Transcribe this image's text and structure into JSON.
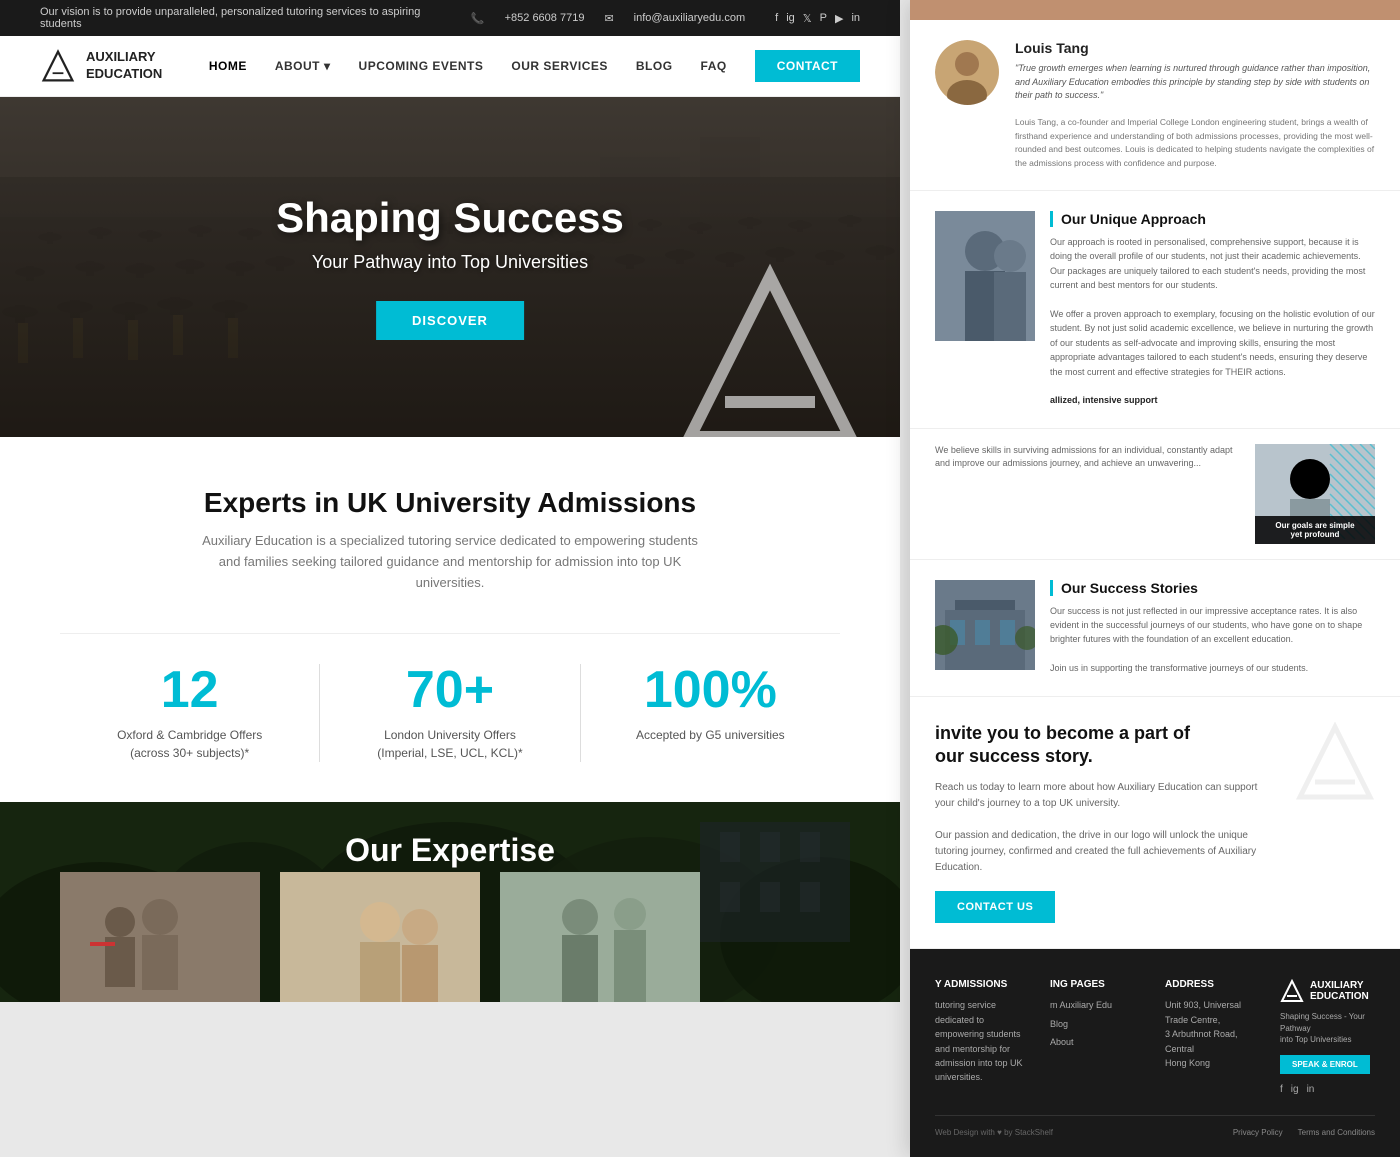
{
  "topbar": {
    "vision_text": "Our vision is to provide unparalleled, personalized tutoring services to aspiring students",
    "phone": "+852 6608 7719",
    "email": "info@auxiliaryedu.com",
    "social_icons": [
      "f",
      "ig",
      "tw",
      "pin",
      "yt",
      "in"
    ]
  },
  "navbar": {
    "logo_name": "AUXILIARY\nEDUCATION",
    "links": [
      {
        "label": "HOME",
        "active": true
      },
      {
        "label": "ABOUT",
        "dropdown": true
      },
      {
        "label": "UPCOMING EVENTS"
      },
      {
        "label": "OUR SERVICES"
      },
      {
        "label": "BLOG"
      },
      {
        "label": "FAQ"
      }
    ],
    "contact_btn": "CONTACT"
  },
  "hero": {
    "title": "Shaping Success",
    "subtitle": "Your Pathway into Top Universities",
    "cta": "DISCOVER"
  },
  "stats": {
    "title": "Experts in UK University Admissions",
    "subtitle": "Auxiliary Education is a specialized tutoring service dedicated to empowering students and families seeking tailored guidance and mentorship for admission into top UK universities.",
    "items": [
      {
        "number": "12",
        "label": "Oxford & Cambridge Offers\n(across 30+ subjects)*"
      },
      {
        "number": "70+",
        "label": "London University Offers\n(Imperial, LSE, UCL, KCL)*"
      },
      {
        "number": "100%",
        "label": "Accepted by G5 universities"
      }
    ]
  },
  "expertise": {
    "title": "Our Expertise"
  },
  "right_panel": {
    "person": {
      "name": "Louis Tang",
      "quote": "\"True growth emerges when learning is nurtured through guidance rather than imposition, and Auxiliary Education embodies this principle by standing step by side with students on their path to success.\"\nLouis Tang, a co-founder and Imperial College London engineering student, brings a wealth of firsthand experience and understanding of both admissions processes, providing the most well-rounded and best outcomes. Louis is dedicated to helping students navigate the complexities of the admissions process with confidence and purpose."
    },
    "approach": {
      "heading": "Our Unique Approach",
      "body": "Our approach is rooted in personalised, comprehensive support, because it is doing the overall profile of our students, not just their academic achievements. Our packages are uniquely tailored to each student's needs, providing the most current and best mentors for our students.\n\nWe offer a proven approach to exemplary, focusing on the holistic evolution of our student. By not just solid academic excellence, we believe in nurturing the growth of our students as self-advocate and improving skills, ensuring the most appropriate advantages tailored to each student's needs, ensuring they deserve the most current and effective strategies for THEIR actions."
    },
    "goals": {
      "badge": "Our goals are simple\nyet profound",
      "text": "We believe skills in surviving admissions for an individual, constantly adapt and improve our admissions journey, and achieve an unwavering..."
    },
    "success": {
      "heading": "Our Success Stories",
      "body": "Our success is not just reflected in our impressive acceptance rates. It is also evident in the successful journeys of our students, who have gone on to shape brighter futures with the foundation of an excellent education.\n\nJoin us in supporting the transformative journeys of our students."
    },
    "cta": {
      "title": "invite you to become a part of\nour success story.",
      "subtitle": "Reach us today to learn more about how Auxiliary Education can support your child's journey to a top UK university.\nOur passion and dedication, the drive in our logo will unlock the unique tutoring journey, confirmed and created the full achievements of Auxiliary Education.",
      "btn": "CONTACT US"
    },
    "footer": {
      "admissions_title": "y Admissions",
      "admissions_text": "tutoring service dedicated to empowering students\nand mentorship for admission into top UK universities.",
      "nav_title": "ing Pages",
      "nav_items": [
        "m Auxiliary Edu",
        "Blog",
        "About"
      ],
      "address_title": "Address",
      "address_text": "Unit 903, Universal Trade Centre,\n3 Arbuthnot Road, Central, Hong Kong",
      "logo_text": "AUXILIARY\nEDUCATION",
      "tagline": "Shaping Success - Your Pathway\ninto Top Universities",
      "btn": "SPEAK & ENROL",
      "copyright": "Web Design with ♥ by StackShelf",
      "links": [
        "Privacy Policy",
        "Terms and Conditions"
      ]
    }
  }
}
